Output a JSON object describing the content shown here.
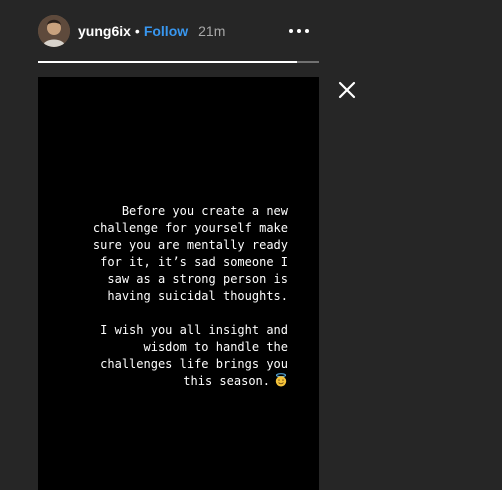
{
  "header": {
    "username": "yung6ix",
    "separator": "•",
    "follow_label": "Follow",
    "time_ago": "21m"
  },
  "story": {
    "progress": 0.92,
    "paragraphs": [
      "Before you create a new\nchallenge for yourself make\nsure you are mentally ready\nfor it, it’s sad someone I\nsaw as a strong person  is\nhaving suicidal thoughts.",
      "I wish you all insight and\nwisdom to handle the\nchallenges life brings you\nthis season."
    ],
    "emoji": "smiling-face-with-halo"
  },
  "icons": {
    "more": "more-options-icon",
    "close": "close-icon"
  },
  "colors": {
    "background": "#262626",
    "story_background": "#000000",
    "follow": "#3897f0",
    "text": "#ffffff",
    "muted": "#a8a8a8"
  }
}
